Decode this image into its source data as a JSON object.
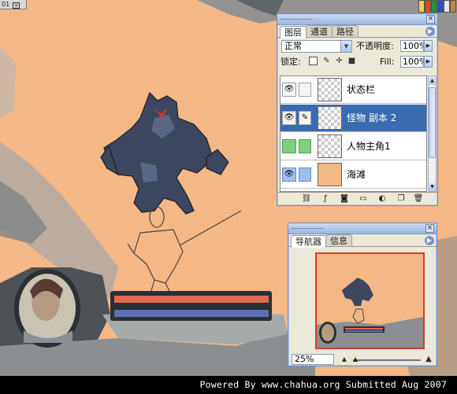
{
  "canvas": {
    "tab_label": "01",
    "art_bg": "#f3b886",
    "health_bar_color": "#e06a4e",
    "mana_bar_color": "#5a6fb8"
  },
  "layers_panel": {
    "tabs": [
      {
        "label": "图层",
        "active": true
      },
      {
        "label": "通道",
        "active": false
      },
      {
        "label": "路径",
        "active": false
      }
    ],
    "blend_mode": "正常",
    "opacity_label": "不透明度:",
    "opacity_value": "100%",
    "lock_label": "锁定:",
    "fill_label": "Fill:",
    "fill_value": "100%",
    "layers": [
      {
        "name": "状态栏",
        "visible": true,
        "selected": false,
        "link_icon": "",
        "thumb": "checker"
      },
      {
        "name": "怪物 副本 2",
        "visible": true,
        "selected": true,
        "link_icon": "brush",
        "thumb": "checker"
      },
      {
        "name": "人物主角1",
        "visible": false,
        "selected": false,
        "link_icon": "",
        "thumb": "checker"
      },
      {
        "name": "海滩",
        "visible": true,
        "selected": false,
        "link_icon": "",
        "thumb": "solid"
      }
    ],
    "selected_color": "#3a6bb0"
  },
  "navigator_panel": {
    "tabs": [
      {
        "label": "导航器",
        "active": true
      },
      {
        "label": "信息",
        "active": false
      }
    ],
    "zoom_value": "25%",
    "view_frame_color": "#d63c2a"
  },
  "footer": {
    "credit": "Powered By www.chahua.org  Submitted Aug 2007"
  }
}
